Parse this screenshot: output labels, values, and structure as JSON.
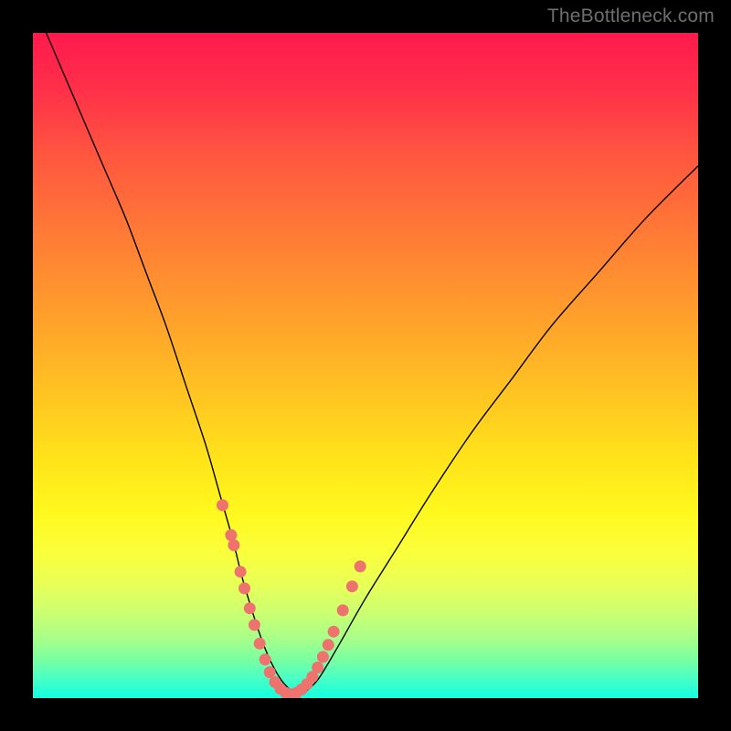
{
  "watermark": "TheBottleneck.com",
  "colors": {
    "frame": "#000000",
    "curve": "#000000",
    "marker": "#ee736f",
    "gradient_top": "#ff1a4d",
    "gradient_bottom": "#12ffe0"
  },
  "chart_data": {
    "type": "line",
    "title": "",
    "xlabel": "",
    "ylabel": "",
    "xlim": [
      0,
      100
    ],
    "ylim": [
      0,
      100
    ],
    "grid": false,
    "legend": false,
    "series": [
      {
        "name": "bottleneck-curve",
        "x": [
          2,
          5,
          8,
          11,
          14,
          17,
          20,
          23,
          26,
          28,
          30,
          31.5,
          33,
          34.5,
          36,
          37.5,
          39,
          40,
          41,
          43,
          46,
          50,
          55,
          60,
          66,
          72,
          78,
          85,
          92,
          100
        ],
        "y": [
          100,
          93,
          86,
          79,
          72,
          64,
          56,
          47,
          38,
          31,
          24,
          18,
          13,
          8.5,
          5,
          2.5,
          1,
          0.5,
          1,
          3,
          8,
          15,
          23,
          31,
          40,
          48,
          56,
          64,
          72,
          80
        ]
      }
    ],
    "markers": {
      "name": "highlight-points",
      "x": [
        28.5,
        29.8,
        30.2,
        31.2,
        31.8,
        32.6,
        33.3,
        34.1,
        34.9,
        35.6,
        36.4,
        37.2,
        38.0,
        38.8,
        39.6,
        40.4,
        41.2,
        42.0,
        42.8,
        43.6,
        44.4,
        45.2,
        46.6,
        48.0,
        49.2
      ],
      "y": [
        29.0,
        24.5,
        23.0,
        19.0,
        16.5,
        13.5,
        11.0,
        8.2,
        5.8,
        3.9,
        2.4,
        1.4,
        0.8,
        0.6,
        0.8,
        1.3,
        2.1,
        3.2,
        4.6,
        6.2,
        8.0,
        10.0,
        13.2,
        16.8,
        19.8
      ]
    }
  }
}
